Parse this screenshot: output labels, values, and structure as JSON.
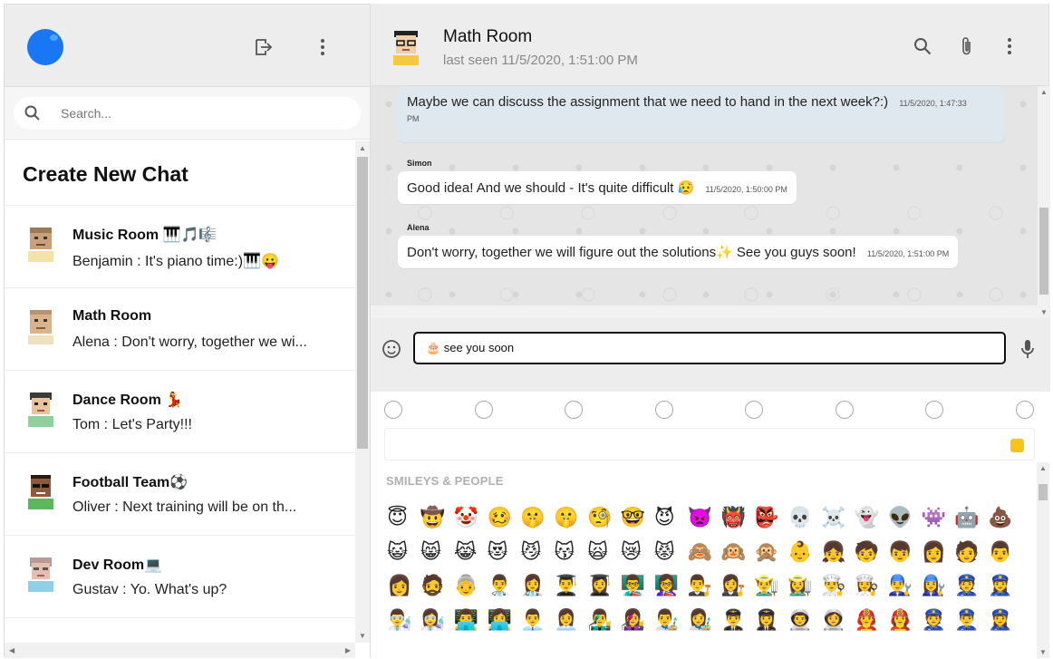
{
  "sidebar": {
    "search": {
      "placeholder": "Search..."
    },
    "create_chat": "Create New Chat",
    "chats": [
      {
        "name": "Music Room 🎹🎵🎼",
        "last": "Benjamin : It's piano time:)🎹😛",
        "avatar_color": "#c8a07a"
      },
      {
        "name": "Math Room",
        "last": "Alena : Don't worry, together we wi...",
        "avatar_color": "#d9b38c"
      },
      {
        "name": "Dance Room 💃",
        "last": "Tom : Let's Party!!!",
        "avatar_color": "#e7c49a"
      },
      {
        "name": "Football Team⚽",
        "last": "Oliver : Next training will be on th...",
        "avatar_color": "#8a5a3a"
      },
      {
        "name": "Dev Room💻",
        "last": "Gustav : Yo. What's up?",
        "avatar_color": "#e7bfb0"
      }
    ]
  },
  "header": {
    "title": "Math Room",
    "last_seen": "last seen 11/5/2020, 1:51:00 PM"
  },
  "messages": [
    {
      "sender": "",
      "text": "Maybe we can discuss the assignment that we need to hand in the next week?:)",
      "time": "11/5/2020, 1:47:33",
      "time2": "PM",
      "mine": true
    },
    {
      "sender": "Simon",
      "text": "Good idea! And we should - It's quite difficult 😥",
      "time": "11/5/2020, 1:50:00 PM",
      "mine": false
    },
    {
      "sender": "Alena",
      "text": "Don't worry, together we will figure out the solutions✨ See you guys soon!",
      "time": "11/5/2020, 1:51:00 PM",
      "mine": false
    }
  ],
  "composer": {
    "value": "🎂 see you soon"
  },
  "picker": {
    "section": "SMILEYS & PEOPLE",
    "rows": [
      [
        "😇",
        "🤠",
        "🤡",
        "🥴",
        "🤫",
        "🤫",
        "🧐",
        "🤓",
        "😈",
        "👿",
        "👹",
        "👺",
        "💀",
        "☠️",
        "👻",
        "👽",
        "👾",
        "🤖",
        "💩"
      ],
      [
        "😺",
        "😸",
        "😹",
        "😻",
        "😼",
        "😽",
        "🙀",
        "😿",
        "😾",
        "🙈",
        "🙉",
        "🙊",
        "👶",
        "👧",
        "🧒",
        "👦",
        "👩",
        "🧑",
        "👨"
      ],
      [
        "👩",
        "🧔",
        "👵",
        "👨‍⚕️",
        "👩‍⚕️",
        "👨‍🎓",
        "👩‍🎓",
        "👨‍🏫",
        "👩‍🏫",
        "👨‍⚖️",
        "👩‍⚖️",
        "👨‍🌾",
        "👩‍🌾",
        "👨‍🍳",
        "👩‍🍳",
        "👨‍🔧",
        "👩‍🔧",
        "👮",
        "👮‍♀️"
      ],
      [
        "👨‍🔬",
        "👩‍🔬",
        "👨‍💻",
        "👩‍💻",
        "👨‍💼",
        "👩‍💼",
        "👨‍🎤",
        "👩‍🎤",
        "👨‍🎨",
        "👩‍🎨",
        "👨‍✈️",
        "👩‍✈️",
        "👨‍🚀",
        "👩‍🚀",
        "👨‍🚒",
        "👩‍🚒",
        "👮",
        "👮‍♂️",
        "👮‍♀️"
      ]
    ]
  }
}
